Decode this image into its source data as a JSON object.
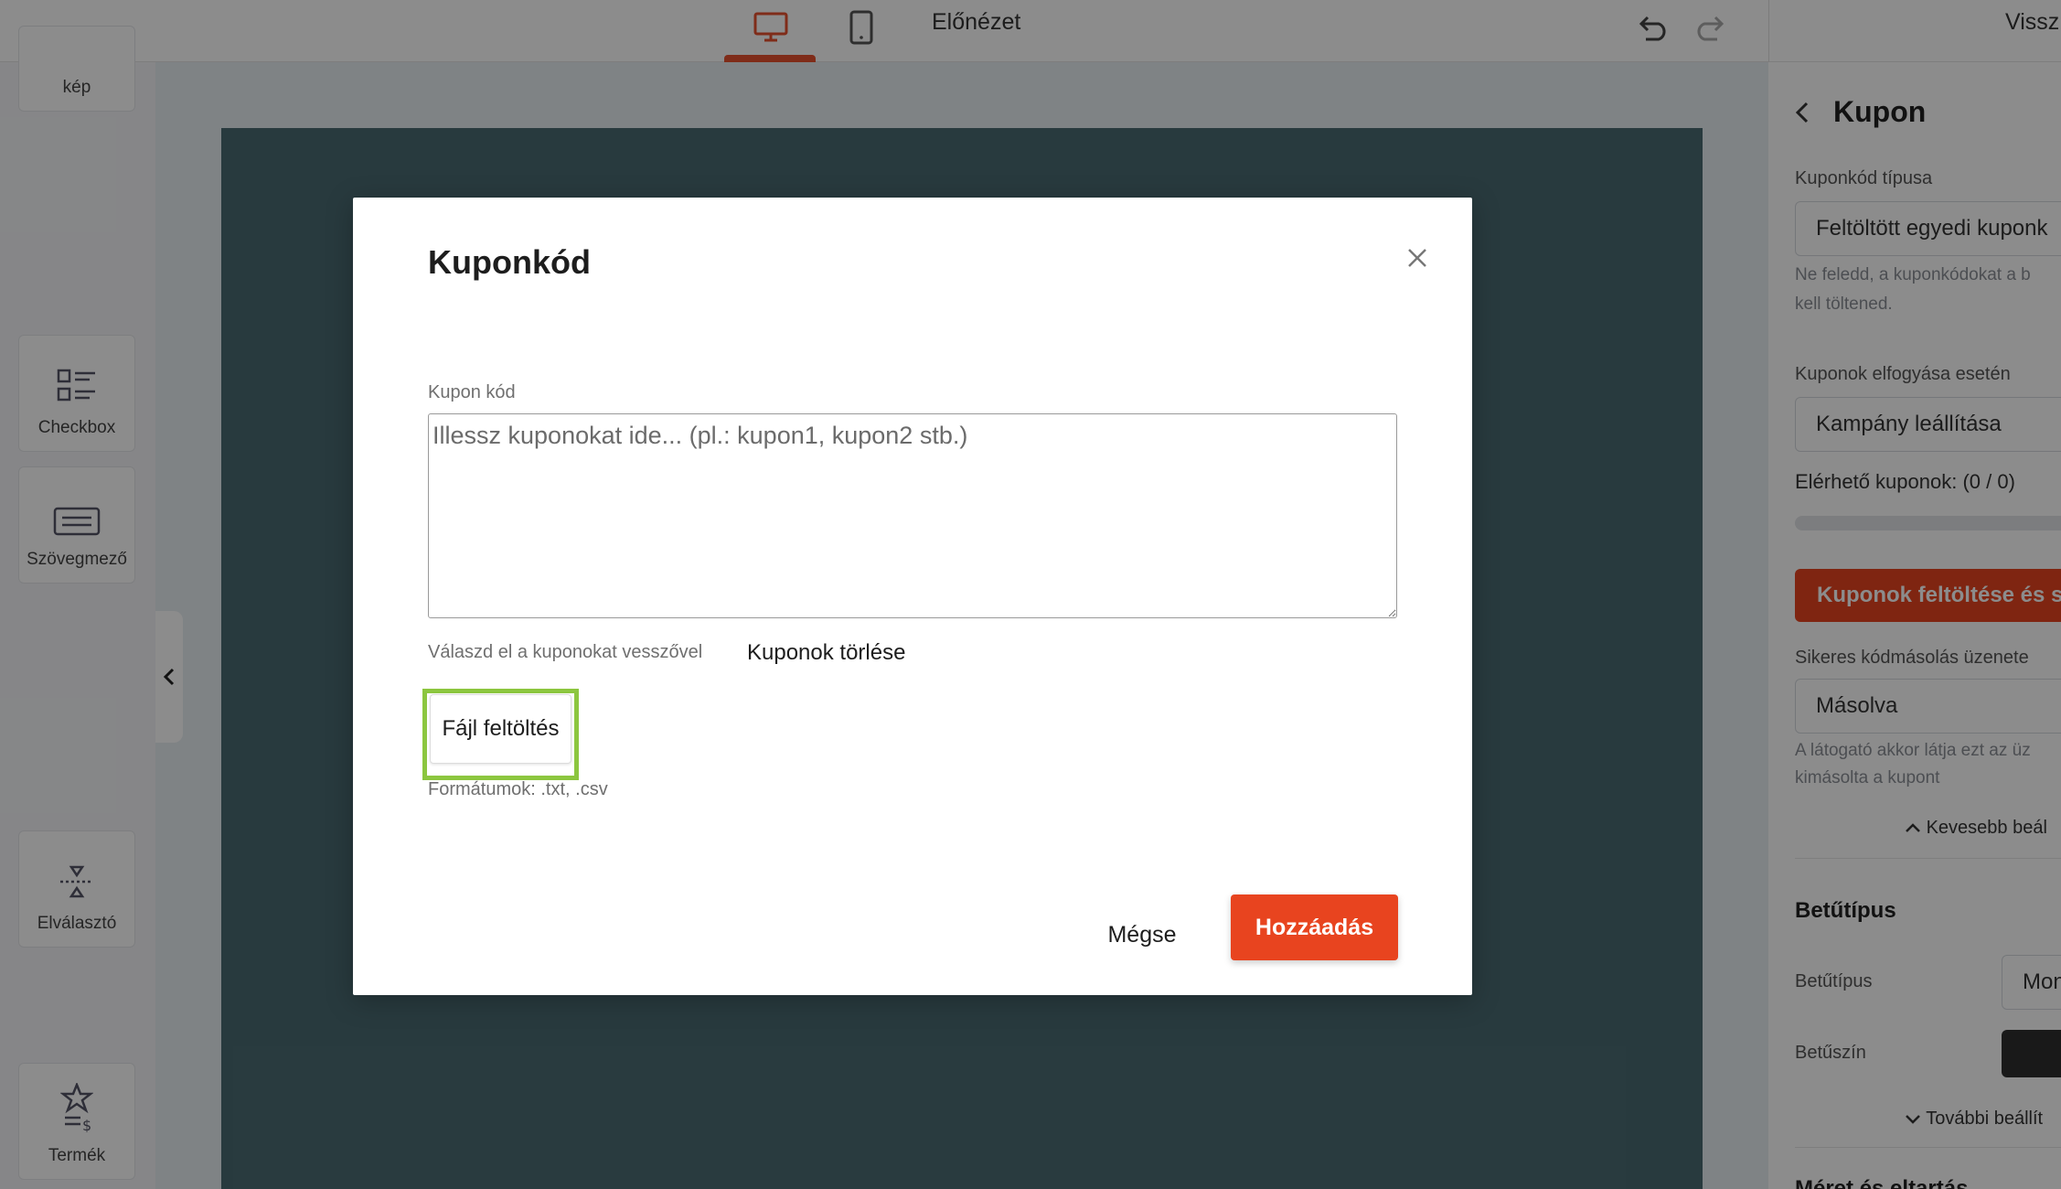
{
  "topbar": {
    "preview_label": "Előnézet",
    "back_label": "Vissz"
  },
  "left_panel": {
    "widgets": [
      {
        "label": "kép",
        "icon": "image-icon"
      },
      {
        "label": "Checkbox",
        "icon": "checkbox-list-icon"
      },
      {
        "label": "Szövegmező",
        "icon": "text-field-icon"
      },
      {
        "label": "Elválasztó",
        "icon": "separator-icon"
      },
      {
        "label": "Termék",
        "icon": "product-icon"
      }
    ]
  },
  "right_panel": {
    "title": "Kupon",
    "coupon_type_label": "Kuponkód típusa",
    "coupon_type_value": "Feltöltött egyedi kuponk",
    "coupon_type_help_1": "Ne feledd, a kuponkódokat a b",
    "coupon_type_help_2": "kell töltened.",
    "on_depletion_label": "Kuponok elfogyása esetén",
    "on_depletion_value": "Kampány leállítása",
    "available_label": "Elérhető kuponok: (0 / 0)",
    "available_progress": 0,
    "upload_button": "Kuponok feltöltése és sz",
    "copy_message_label": "Sikeres kódmásolás üzenete",
    "copy_message_value": "Másolva",
    "copy_help_1": "A látogató akkor látja ezt az üz",
    "copy_help_2": "kimásolta a kupont",
    "less_settings": "Kevesebb beál",
    "font_heading": "Betűtípus",
    "font_label": "Betűtípus",
    "font_value": "Mon",
    "font_color_label": "Betűszín",
    "more_settings": "További beállít",
    "size_heading": "Méret és eltartás"
  },
  "modal": {
    "title": "Kuponkód",
    "field_label": "Kupon kód",
    "textarea_placeholder": "Illessz kuponokat ide... (pl.: kupon1, kupon2 stb.)",
    "comma_hint": "Válaszd el a kuponokat vesszővel",
    "delete_coupons": "Kuponok törlése",
    "upload_button": "Fájl feltöltés",
    "formats_hint": "Formátumok: .txt, .csv",
    "cancel_button": "Mégse",
    "add_button": "Hozzáadás"
  },
  "colors": {
    "accent": "#e8441f",
    "highlight": "#8cc63f",
    "canvas": "#4a6b72"
  }
}
